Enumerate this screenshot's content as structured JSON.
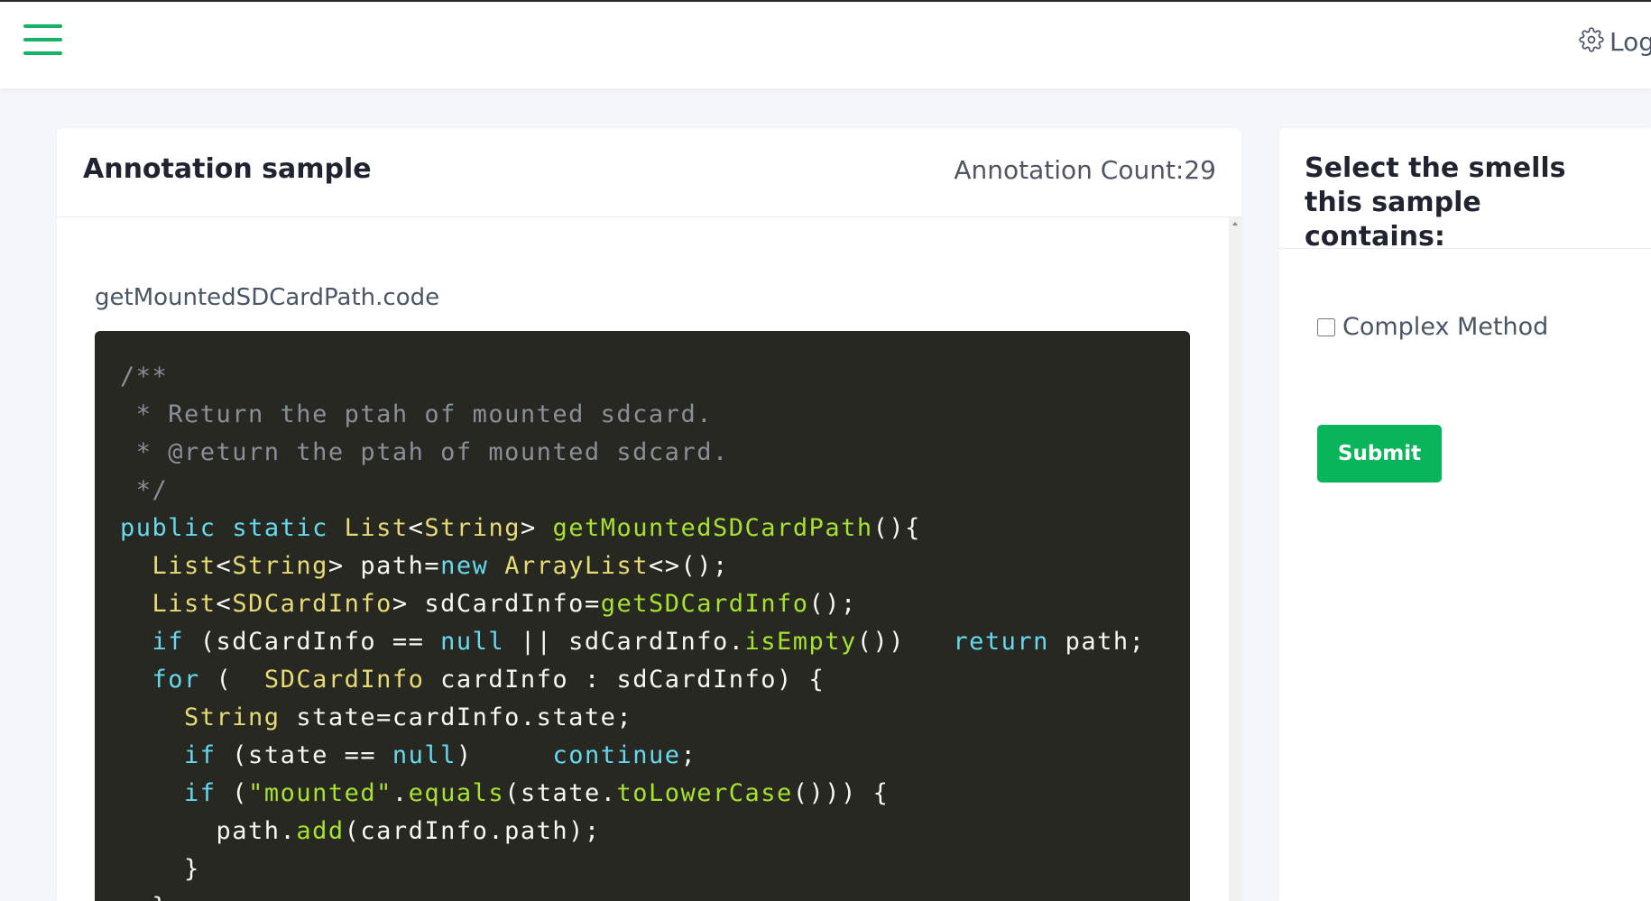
{
  "topbar": {
    "menu_icon": "hamburger-menu-icon",
    "settings_icon": "gear-icon",
    "right_label": "Log",
    "accent_color": "#17b26a"
  },
  "sample": {
    "title": "Annotation sample",
    "count_label": "Annotation Count:29",
    "filename": "getMountedSDCardPath.code",
    "code_lines": [
      [
        {
          "t": "/**",
          "c": "cm"
        }
      ],
      [
        {
          "t": " * Return the ptah of mounted sdcard.",
          "c": "cm"
        }
      ],
      [
        {
          "t": " * @return the ptah of mounted sdcard.",
          "c": "cm"
        }
      ],
      [
        {
          "t": " */",
          "c": "cm"
        }
      ],
      [
        {
          "t": "public",
          "c": "kw"
        },
        {
          "t": " ",
          "c": "pl"
        },
        {
          "t": "static",
          "c": "kw"
        },
        {
          "t": " ",
          "c": "pl"
        },
        {
          "t": "List",
          "c": "ty"
        },
        {
          "t": "<",
          "c": "pl"
        },
        {
          "t": "String",
          "c": "ty"
        },
        {
          "t": "> ",
          "c": "pl"
        },
        {
          "t": "getMountedSDCardPath",
          "c": "fn"
        },
        {
          "t": "(){",
          "c": "pl"
        }
      ],
      [
        {
          "t": "  ",
          "c": "pl"
        },
        {
          "t": "List",
          "c": "ty"
        },
        {
          "t": "<",
          "c": "pl"
        },
        {
          "t": "String",
          "c": "ty"
        },
        {
          "t": "> path=",
          "c": "pl"
        },
        {
          "t": "new",
          "c": "kw"
        },
        {
          "t": " ",
          "c": "pl"
        },
        {
          "t": "ArrayList",
          "c": "ty"
        },
        {
          "t": "<>();",
          "c": "pl"
        }
      ],
      [
        {
          "t": "  ",
          "c": "pl"
        },
        {
          "t": "List",
          "c": "ty"
        },
        {
          "t": "<",
          "c": "pl"
        },
        {
          "t": "SDCardInfo",
          "c": "ty"
        },
        {
          "t": "> sdCardInfo=",
          "c": "pl"
        },
        {
          "t": "getSDCardInfo",
          "c": "fn"
        },
        {
          "t": "();",
          "c": "pl"
        }
      ],
      [
        {
          "t": "  ",
          "c": "pl"
        },
        {
          "t": "if",
          "c": "kw"
        },
        {
          "t": " (sdCardInfo == ",
          "c": "pl"
        },
        {
          "t": "null",
          "c": "nu"
        },
        {
          "t": " || sdCardInfo.",
          "c": "pl"
        },
        {
          "t": "isEmpty",
          "c": "fn"
        },
        {
          "t": "())   ",
          "c": "pl"
        },
        {
          "t": "return",
          "c": "kw"
        },
        {
          "t": " path;",
          "c": "pl"
        }
      ],
      [
        {
          "t": "  ",
          "c": "pl"
        },
        {
          "t": "for",
          "c": "kw"
        },
        {
          "t": " (  ",
          "c": "pl"
        },
        {
          "t": "SDCardInfo",
          "c": "ty"
        },
        {
          "t": " cardInfo : sdCardInfo) {",
          "c": "pl"
        }
      ],
      [
        {
          "t": "    ",
          "c": "pl"
        },
        {
          "t": "String",
          "c": "ty"
        },
        {
          "t": " state=cardInfo.state;",
          "c": "pl"
        }
      ],
      [
        {
          "t": "    ",
          "c": "pl"
        },
        {
          "t": "if",
          "c": "kw"
        },
        {
          "t": " (state == ",
          "c": "pl"
        },
        {
          "t": "null",
          "c": "nu"
        },
        {
          "t": ")     ",
          "c": "pl"
        },
        {
          "t": "continue",
          "c": "kw"
        },
        {
          "t": ";",
          "c": "pl"
        }
      ],
      [
        {
          "t": "    ",
          "c": "pl"
        },
        {
          "t": "if",
          "c": "kw"
        },
        {
          "t": " (",
          "c": "pl"
        },
        {
          "t": "\"mounted\"",
          "c": "st"
        },
        {
          "t": ".",
          "c": "pl"
        },
        {
          "t": "equals",
          "c": "fn"
        },
        {
          "t": "(state.",
          "c": "pl"
        },
        {
          "t": "toLowerCase",
          "c": "fn"
        },
        {
          "t": "())) {",
          "c": "pl"
        }
      ],
      [
        {
          "t": "      path.",
          "c": "pl"
        },
        {
          "t": "add",
          "c": "fn"
        },
        {
          "t": "(cardInfo.path);",
          "c": "pl"
        }
      ],
      [
        {
          "t": "    }",
          "c": "pl"
        }
      ],
      [
        {
          "t": "  }",
          "c": "pl"
        }
      ]
    ]
  },
  "smells": {
    "heading": "Select the smells this sample contains:",
    "options": [
      {
        "label": "Complex Method",
        "checked": false
      }
    ],
    "submit_label": "Submit",
    "submit_color": "#0ab45a"
  }
}
